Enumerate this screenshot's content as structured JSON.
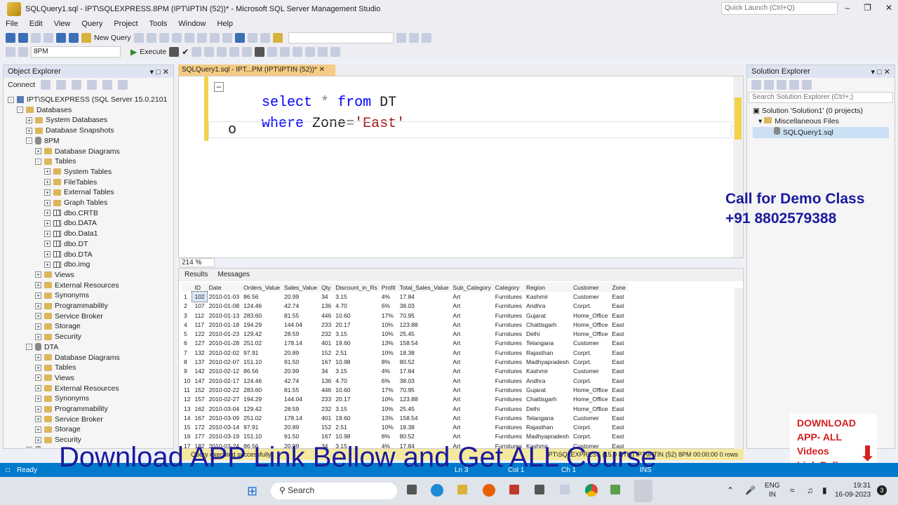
{
  "window": {
    "title": "SQLQuery1.sql - IPT\\SQLEXPRESS.8PM (IPT\\IPTIN (52))* - Microsoft SQL Server Management Studio",
    "quick_launch": "Quick Launch (Ctrl+Q)"
  },
  "menu": [
    "File",
    "Edit",
    "View",
    "Query",
    "Project",
    "Tools",
    "Window",
    "Help"
  ],
  "toolbar": {
    "new_query": "New Query",
    "db_select": "8PM",
    "execute": "Execute"
  },
  "object_explorer": {
    "title": "Object Explorer",
    "connect": "Connect",
    "nodes": [
      {
        "t": "IPT\\SQLEXPRESS (SQL Server 15.0.2101 - IPT\\",
        "l": 0,
        "k": "srv",
        "e": "-"
      },
      {
        "t": "Databases",
        "l": 1,
        "k": "fold",
        "e": "-"
      },
      {
        "t": "System Databases",
        "l": 2,
        "k": "fold",
        "e": "+"
      },
      {
        "t": "Database Snapshots",
        "l": 2,
        "k": "fold",
        "e": "+"
      },
      {
        "t": "8PM",
        "l": 2,
        "k": "db",
        "e": "-"
      },
      {
        "t": "Database Diagrams",
        "l": 3,
        "k": "fold",
        "e": "+"
      },
      {
        "t": "Tables",
        "l": 3,
        "k": "fold",
        "e": "-"
      },
      {
        "t": "System Tables",
        "l": 4,
        "k": "fold",
        "e": "+"
      },
      {
        "t": "FileTables",
        "l": 4,
        "k": "fold",
        "e": "+"
      },
      {
        "t": "External Tables",
        "l": 4,
        "k": "fold",
        "e": "+"
      },
      {
        "t": "Graph Tables",
        "l": 4,
        "k": "fold",
        "e": "+"
      },
      {
        "t": "dbo.CRTB",
        "l": 4,
        "k": "tbl",
        "e": "+"
      },
      {
        "t": "dbo.DATA",
        "l": 4,
        "k": "tbl",
        "e": "+"
      },
      {
        "t": "dbo.Data1",
        "l": 4,
        "k": "tbl",
        "e": "+"
      },
      {
        "t": "dbo.DT",
        "l": 4,
        "k": "tbl",
        "e": "+"
      },
      {
        "t": "dbo.DTA",
        "l": 4,
        "k": "tbl",
        "e": "+"
      },
      {
        "t": "dbo.img",
        "l": 4,
        "k": "tbl",
        "e": "+"
      },
      {
        "t": "Views",
        "l": 3,
        "k": "fold",
        "e": "+"
      },
      {
        "t": "External Resources",
        "l": 3,
        "k": "fold",
        "e": "+"
      },
      {
        "t": "Synonyms",
        "l": 3,
        "k": "fold",
        "e": "+"
      },
      {
        "t": "Programmability",
        "l": 3,
        "k": "fold",
        "e": "+"
      },
      {
        "t": "Service Broker",
        "l": 3,
        "k": "fold",
        "e": "+"
      },
      {
        "t": "Storage",
        "l": 3,
        "k": "fold",
        "e": "+"
      },
      {
        "t": "Security",
        "l": 3,
        "k": "fold",
        "e": "+"
      },
      {
        "t": "DTA",
        "l": 2,
        "k": "db",
        "e": "-"
      },
      {
        "t": "Database Diagrams",
        "l": 3,
        "k": "fold",
        "e": "+"
      },
      {
        "t": "Tables",
        "l": 3,
        "k": "fold",
        "e": "+"
      },
      {
        "t": "Views",
        "l": 3,
        "k": "fold",
        "e": "+"
      },
      {
        "t": "External Resources",
        "l": 3,
        "k": "fold",
        "e": "+"
      },
      {
        "t": "Synonyms",
        "l": 3,
        "k": "fold",
        "e": "+"
      },
      {
        "t": "Programmability",
        "l": 3,
        "k": "fold",
        "e": "+"
      },
      {
        "t": "Service Broker",
        "l": 3,
        "k": "fold",
        "e": "+"
      },
      {
        "t": "Storage",
        "l": 3,
        "k": "fold",
        "e": "+"
      },
      {
        "t": "Security",
        "l": 3,
        "k": "fold",
        "e": "+"
      },
      {
        "t": "FR",
        "l": 2,
        "k": "db",
        "e": "+"
      }
    ]
  },
  "editor": {
    "tab": "SQLQuery1.sql - IPT...PM (IPT\\IPTIN (52))*",
    "zoom": "214 %",
    "line1_kw1": "select",
    "line1_star": "*",
    "line1_kw2": "from",
    "line1_tbl": "DT",
    "line2_kw": "where",
    "line2_col": "Zone",
    "line2_eq": "=",
    "line2_str": "'East'",
    "line3": "o"
  },
  "results": {
    "tab_results": "Results",
    "tab_messages": "Messages",
    "columns": [
      "ID",
      "Date",
      "Orders_Value",
      "Sales_Value",
      "Qty",
      "Discount_in_Rs",
      "Profit",
      "Total_Sales_Value",
      "Sub_Category",
      "Category",
      "Region",
      "Customer",
      "Zone"
    ],
    "rows": [
      [
        "1",
        "102",
        "2010-01-03",
        "86.56",
        "20.99",
        "34",
        "3.15",
        "4%",
        "17.84",
        "Art",
        "Furnitures",
        "Kashmir",
        "Customer",
        "East"
      ],
      [
        "2",
        "107",
        "2010-01-08",
        "124.46",
        "42.74",
        "136",
        "4.70",
        "6%",
        "38.03",
        "Art",
        "Furnitures",
        "Andhra",
        "Corprt.",
        "East"
      ],
      [
        "3",
        "112",
        "2010-01-13",
        "283.60",
        "81.55",
        "446",
        "10.60",
        "17%",
        "70.95",
        "Art",
        "Furnitures",
        "Gujarat",
        "Home_Office",
        "East"
      ],
      [
        "4",
        "117",
        "2010-01-18",
        "194.29",
        "144.04",
        "233",
        "20.17",
        "10%",
        "123.88",
        "Art",
        "Furnitures",
        "Chattisgarh",
        "Home_Office",
        "East"
      ],
      [
        "5",
        "122",
        "2010-01-23",
        "129.42",
        "28.59",
        "232",
        "3.15",
        "10%",
        "25.45",
        "Art",
        "Furnitures",
        "Delhi",
        "Home_Office",
        "East"
      ],
      [
        "6",
        "127",
        "2010-01-28",
        "251.02",
        "178.14",
        "401",
        "19.60",
        "13%",
        "158.54",
        "Art",
        "Furnitures",
        "Telangana",
        "Customer",
        "East"
      ],
      [
        "7",
        "132",
        "2010-02-02",
        "97.91",
        "20.89",
        "152",
        "2.51",
        "10%",
        "18.38",
        "Art",
        "Furnitures",
        "Rajasthan",
        "Corprt.",
        "East"
      ],
      [
        "8",
        "137",
        "2010-02-07",
        "151.10",
        "91.50",
        "167",
        "10.98",
        "8%",
        "80.52",
        "Art",
        "Furnitures",
        "Madhyapradesh",
        "Corprt.",
        "East"
      ],
      [
        "9",
        "142",
        "2010-02-12",
        "86.56",
        "20.99",
        "34",
        "3.15",
        "4%",
        "17.84",
        "Art",
        "Furnitures",
        "Kashmir",
        "Customer",
        "East"
      ],
      [
        "10",
        "147",
        "2010-02-17",
        "124.46",
        "42.74",
        "136",
        "4.70",
        "6%",
        "38.03",
        "Art",
        "Furnitures",
        "Andhra",
        "Corprt.",
        "East"
      ],
      [
        "11",
        "152",
        "2010-02-22",
        "283.60",
        "81.55",
        "446",
        "10.60",
        "17%",
        "70.95",
        "Art",
        "Furnitures",
        "Gujarat",
        "Home_Office",
        "East"
      ],
      [
        "12",
        "157",
        "2010-02-27",
        "194.29",
        "144.04",
        "233",
        "20.17",
        "10%",
        "123.88",
        "Art",
        "Furnitures",
        "Chattisgarh",
        "Home_Office",
        "East"
      ],
      [
        "13",
        "162",
        "2010-03-04",
        "129.42",
        "28.59",
        "232",
        "3.15",
        "10%",
        "25.45",
        "Art",
        "Furnitures",
        "Delhi",
        "Home_Office",
        "East"
      ],
      [
        "14",
        "167",
        "2010-03-09",
        "251.02",
        "178.14",
        "401",
        "19.60",
        "13%",
        "158.54",
        "Art",
        "Furnitures",
        "Telangana",
        "Customer",
        "East"
      ],
      [
        "15",
        "172",
        "2010-03-14",
        "97.91",
        "20.89",
        "152",
        "2.51",
        "10%",
        "18.38",
        "Art",
        "Furnitures",
        "Rajasthan",
        "Corprt.",
        "East"
      ],
      [
        "16",
        "177",
        "2010-03-19",
        "151.10",
        "91.50",
        "167",
        "10.98",
        "8%",
        "80.52",
        "Art",
        "Furnitures",
        "Madhyapradesh",
        "Corprt.",
        "East"
      ],
      [
        "17",
        "182",
        "2010-03-24",
        "86.56",
        "20.99",
        "34",
        "3.15",
        "4%",
        "17.84",
        "Art",
        "Furnitures",
        "Kashmir",
        "Customer",
        "East"
      ]
    ]
  },
  "query_status": {
    "msg": "Query executed successfully.",
    "right": "IPT\\SQLEXPRESS (15.0 RTM)   IPT\\IPTIN (52)   8PM   00:00:00   0 rows"
  },
  "solution_explorer": {
    "title": "Solution Explorer",
    "search": "Search Solution Explorer (Ctrl+;)",
    "solution": "Solution 'Solution1' (0 projects)",
    "misc": "Miscellaneous Files",
    "file": "SQLQuery1.sql"
  },
  "statusbar": {
    "ready": "Ready",
    "ln": "Ln 3",
    "col": "Col 1",
    "ch": "Ch 1",
    "ins": "INS"
  },
  "promo": {
    "line1": "Call for Demo Class",
    "line2": "+91 8802579388",
    "download": "DOWNLOAD",
    "download2": "APP- ALL Videos",
    "download3": "Link Bellow",
    "banner": "Download APP Link Bellow and Get ALL Course"
  },
  "taskbar": {
    "search": "Search",
    "lang1": "ENG",
    "lang2": "IN",
    "time": "19:31",
    "date": "16-09-2023"
  },
  "colors": {
    "accent": "#007acc",
    "tab_active": "#f5cc84",
    "promo_blue": "#1a1a9e",
    "promo_red": "#d42020"
  }
}
